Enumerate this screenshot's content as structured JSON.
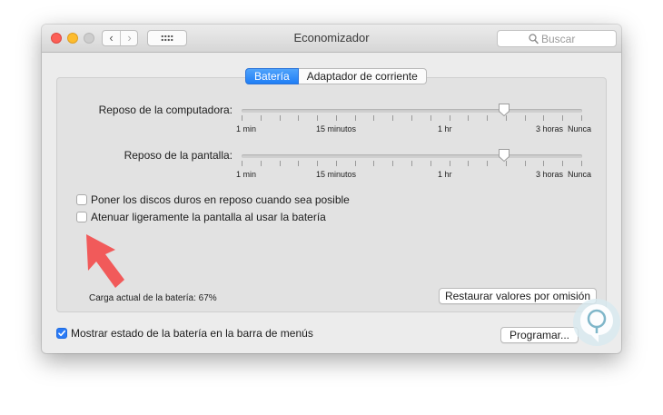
{
  "window": {
    "title": "Economizador",
    "search_placeholder": "Buscar",
    "back_icon": "chevron-left-icon",
    "forward_icon": "chevron-right-icon",
    "grid_icon": "grid-icon"
  },
  "tabs": [
    {
      "label": "Batería",
      "selected": true
    },
    {
      "label": "Adaptador de corriente",
      "selected": false
    }
  ],
  "sliders": [
    {
      "label": "Reposo de la computadora:",
      "tick_labels": [
        "1 min",
        "15 minutos",
        "1 hr",
        "3 horas",
        "Nunca"
      ],
      "value_fraction": 0.77
    },
    {
      "label": "Reposo de la pantalla:",
      "tick_labels": [
        "1 min",
        "15 minutos",
        "1 hr",
        "3 horas",
        "Nunca"
      ],
      "value_fraction": 0.77
    }
  ],
  "options": [
    {
      "label": "Poner los discos duros en reposo cuando sea posible",
      "checked": false
    },
    {
      "label": "Atenuar ligeramente la pantalla al usar la batería",
      "checked": false
    }
  ],
  "battery_charge_text": "Carga actual de la batería: 67%",
  "restore_button": "Restaurar valores por omisión",
  "show_status": {
    "label": "Mostrar estado de la batería en la barra de menús",
    "checked": true
  },
  "schedule_button": "Programar...",
  "colors": {
    "accent": "#2a7af5",
    "arrow": "#f15a5a",
    "close": "#fc5f57",
    "minimize": "#fdbc2e"
  }
}
